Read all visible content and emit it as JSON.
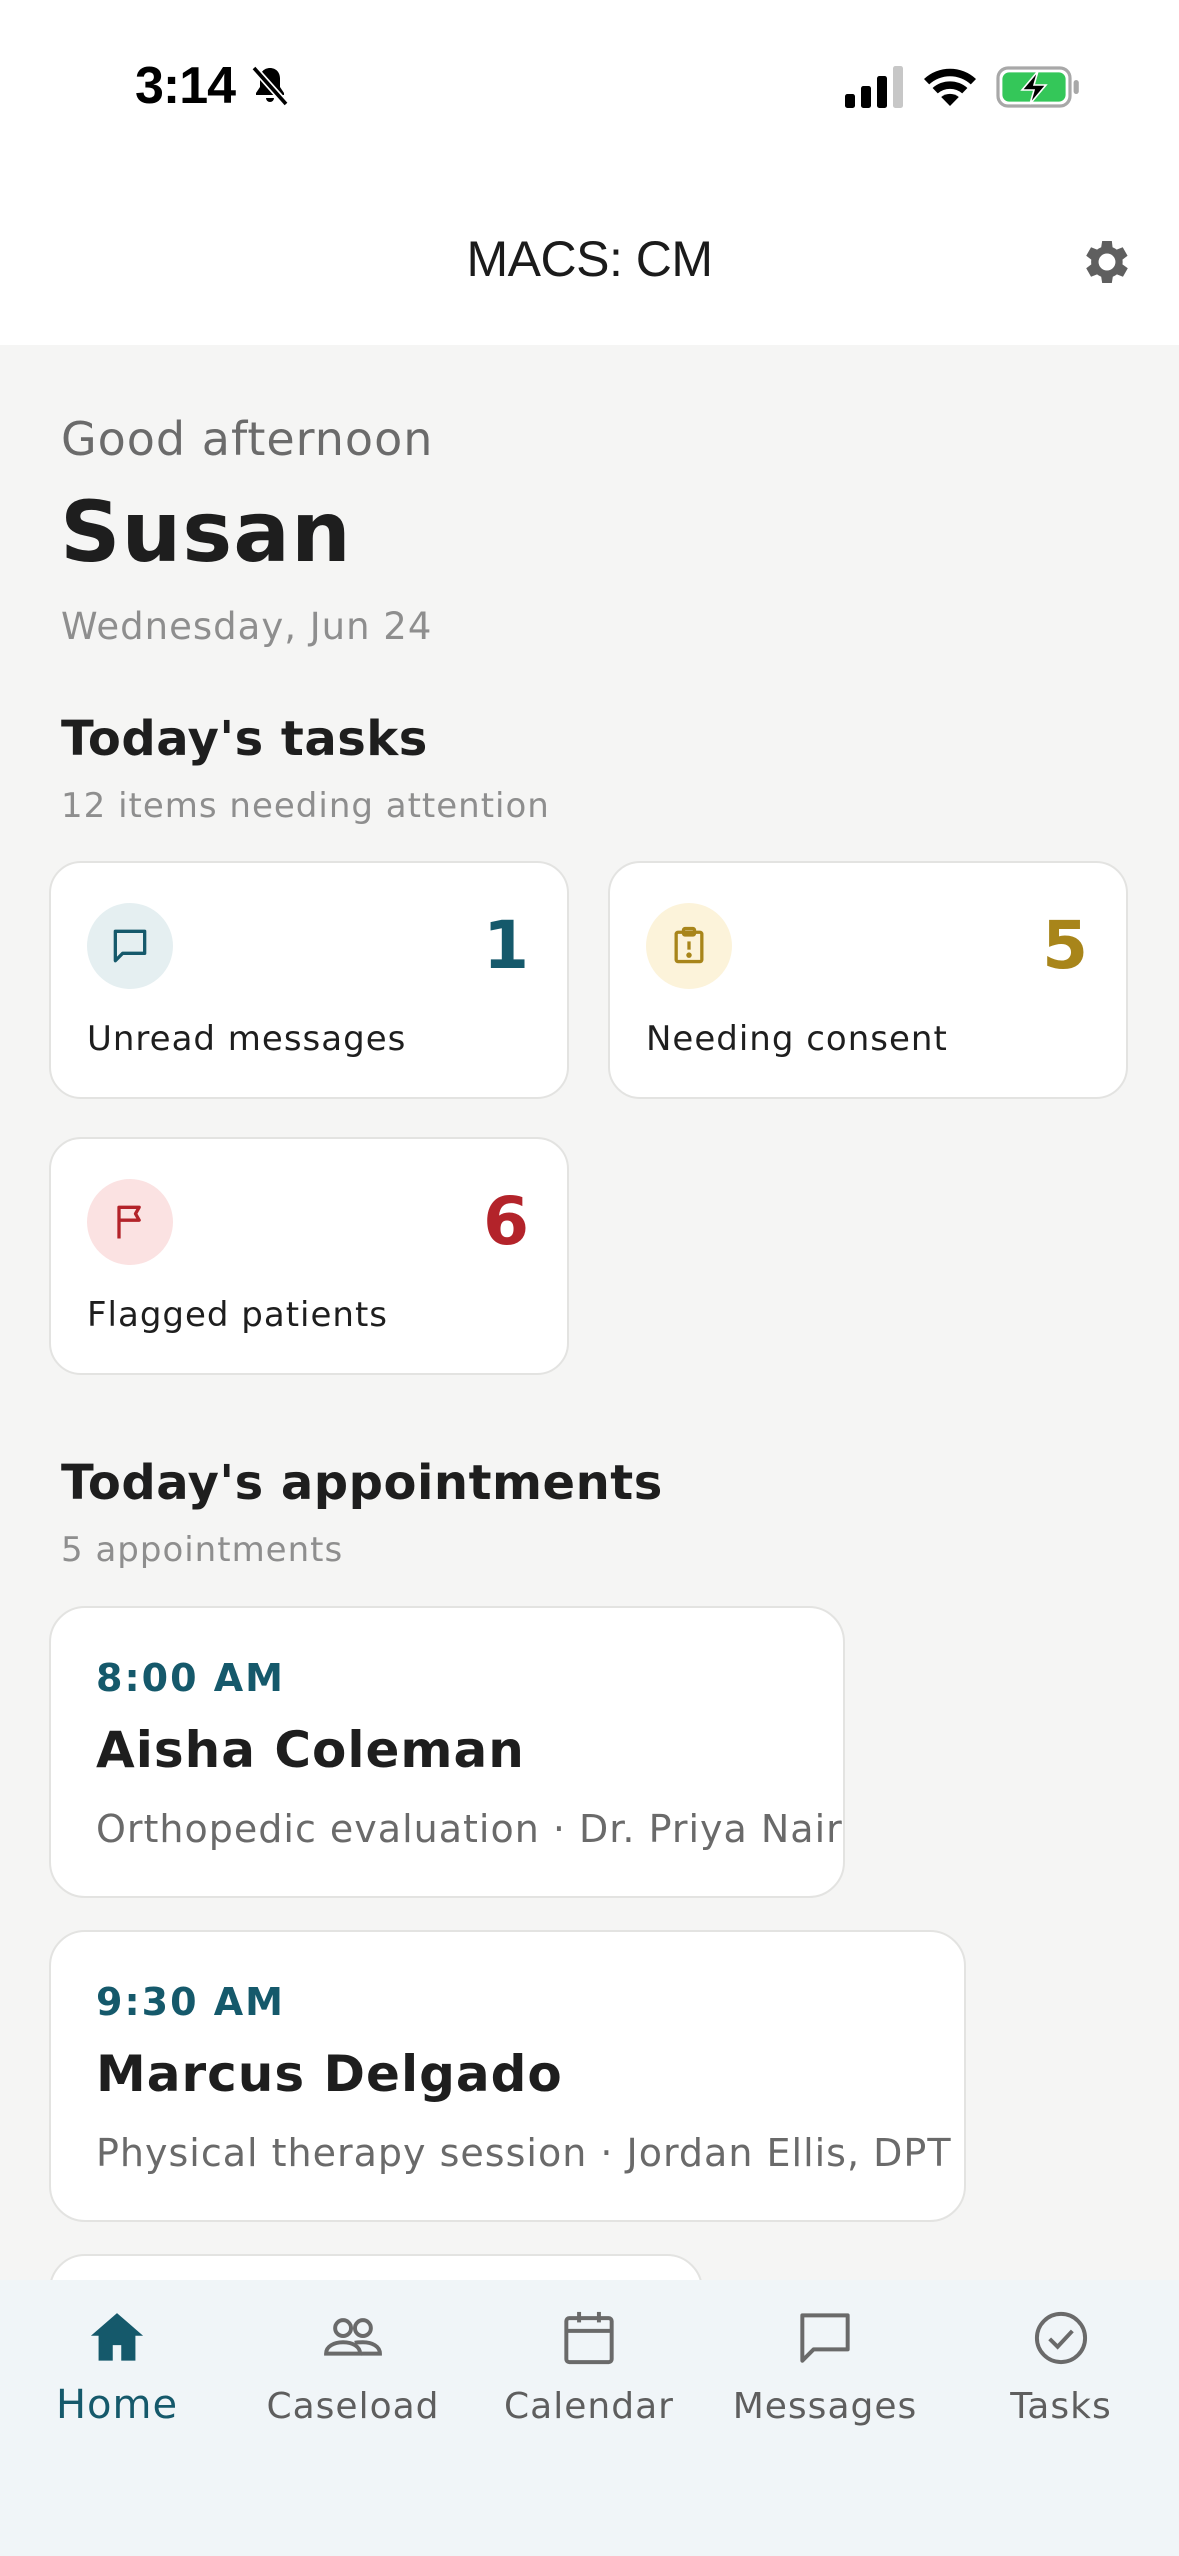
{
  "status_bar": {
    "time": "3:14"
  },
  "header": {
    "title": "MACS: CM"
  },
  "greeting": {
    "salutation": "Good afternoon",
    "name": "Susan",
    "date": "Wednesday, Jun 24"
  },
  "tasks": {
    "title": "Today's tasks",
    "subtitle": "12 items needing attention",
    "items": [
      {
        "label": "Unread messages",
        "count": "1",
        "icon": "chat-bubble-icon",
        "accent": "#15596b",
        "icon_bg": "#e5eff1"
      },
      {
        "label": "Needing consent",
        "count": "5",
        "icon": "clipboard-alert-icon",
        "accent": "#a8851a",
        "icon_bg": "#fcf3da"
      },
      {
        "label": "Flagged patients",
        "count": "6",
        "icon": "flag-icon",
        "accent": "#b3232a",
        "icon_bg": "#fbe2e2"
      }
    ]
  },
  "appointments": {
    "title": "Today's appointments",
    "subtitle": "5 appointments",
    "items": [
      {
        "time": "8:00 AM",
        "patient": "Aisha Coleman",
        "detail": "Orthopedic evaluation · Dr. Priya Nair"
      },
      {
        "time": "9:30 AM",
        "patient": "Marcus Delgado",
        "detail": "Physical therapy session · Jordan Ellis, DPT"
      }
    ]
  },
  "tab_bar": {
    "active_color": "#15596b",
    "items": [
      {
        "label": "Home",
        "icon": "home-icon"
      },
      {
        "label": "Caseload",
        "icon": "people-icon"
      },
      {
        "label": "Calendar",
        "icon": "calendar-icon"
      },
      {
        "label": "Messages",
        "icon": "message-icon"
      },
      {
        "label": "Tasks",
        "icon": "check-circle-icon"
      }
    ]
  }
}
